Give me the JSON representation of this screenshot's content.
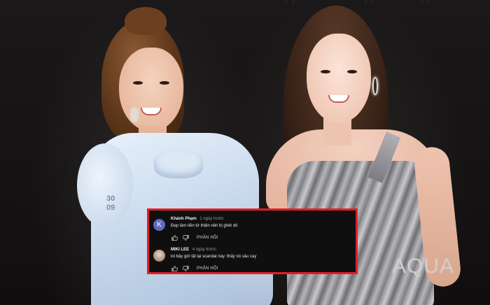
{
  "comments": [
    {
      "author": "Khánh Phạm",
      "time": "1 ngày trước",
      "avatar_letter": "K",
      "text": "Đẹp làm tiền từ thiện nên bị ghét dó",
      "reply_label": "PHẢN HỒI"
    },
    {
      "author": "MIKI LEE",
      "time": "4 ngày trước",
      "text": "lol bây giờ lật lại scandal này :thấy nó sâu cay",
      "reply_label": "PHẢN HỒI"
    }
  ],
  "photo": {
    "dress_tag": [
      "30",
      "09"
    ],
    "backdrop_logo": "AQUA"
  },
  "colors": {
    "highlight_border": "#e31e24",
    "panel_background": "#0f0f0f",
    "avatar_k": "#5c6bc0"
  },
  "icons": [
    "like-icon",
    "dislike-icon"
  ]
}
